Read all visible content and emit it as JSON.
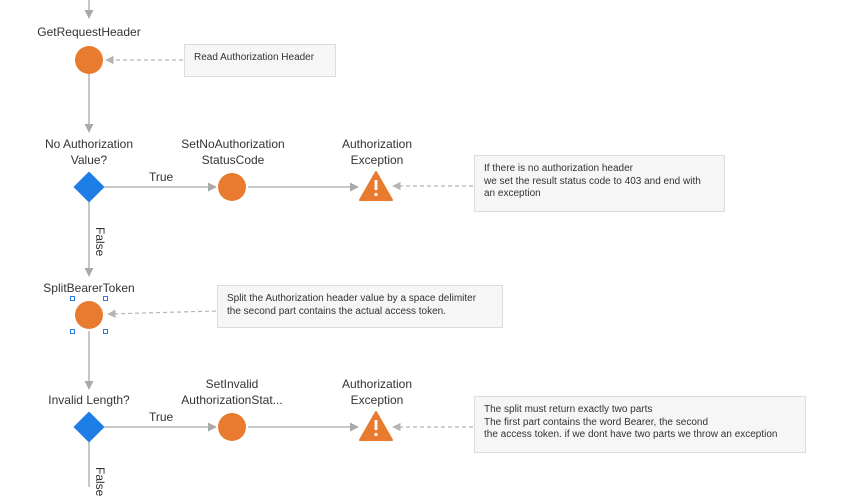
{
  "nodes": {
    "get_request_header": {
      "lines": [
        "GetRequestHeader"
      ]
    },
    "no_authorization_value": {
      "lines": [
        "No Authorization",
        "Value?"
      ]
    },
    "set_no_authorization_statuscode": {
      "lines": [
        "SetNoAuthorization",
        "StatusCode"
      ]
    },
    "authorization_exception_1": {
      "lines": [
        "Authorization",
        "Exception"
      ]
    },
    "split_bearer_token": {
      "lines": [
        "SplitBearerToken"
      ]
    },
    "invalid_length": {
      "lines": [
        "Invalid Length?"
      ]
    },
    "set_invalid_authorization_status": {
      "lines": [
        "SetInvalid",
        "AuthorizationStat..."
      ]
    },
    "authorization_exception_2": {
      "lines": [
        "Authorization",
        "Exception"
      ]
    }
  },
  "edge_labels": {
    "true_1": "True",
    "false_1": "False",
    "true_2": "True",
    "false_2": "False"
  },
  "comments": {
    "read_header": [
      "Read Authorization Header"
    ],
    "no_header": [
      "If there is no authorization header",
      "we set the result status code to 403 and end with",
      "an exception"
    ],
    "split_token": [
      "Split the Authorization header value by a space delimiter",
      "the second part contains the actual access token."
    ],
    "split_length": [
      "The split must return exactly two parts",
      "The first part contains the word Bearer, the second",
      "the access token. if we dont have two parts we throw an exception"
    ]
  },
  "colors": {
    "action_node": "#e87b2f",
    "decision_node": "#1f7ee6",
    "exception_node": "#e87b2f",
    "connector": "#a9a9a9",
    "comment_link": "#b5b5b5",
    "selection_handle": "#2c7be5"
  },
  "icons": {
    "exception": "warning-icon"
  }
}
